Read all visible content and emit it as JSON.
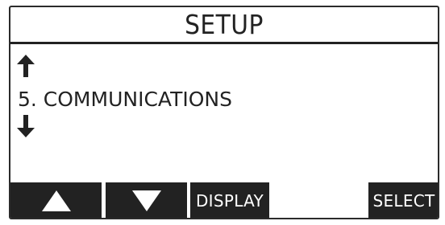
{
  "screen": {
    "title": "SETUP",
    "menu_item": "5. COMMUNICATIONS",
    "icons": {
      "scroll_up": "arrow-up-icon",
      "scroll_down": "arrow-down-icon"
    }
  },
  "softkeys": {
    "up": {
      "icon": "triangle-up-icon"
    },
    "down": {
      "icon": "triangle-down-icon"
    },
    "display_label": "DISPLAY",
    "select_label": "SELECT"
  },
  "colors": {
    "foreground": "#222222",
    "background": "#ffffff",
    "softkey_text": "#ffffff"
  }
}
